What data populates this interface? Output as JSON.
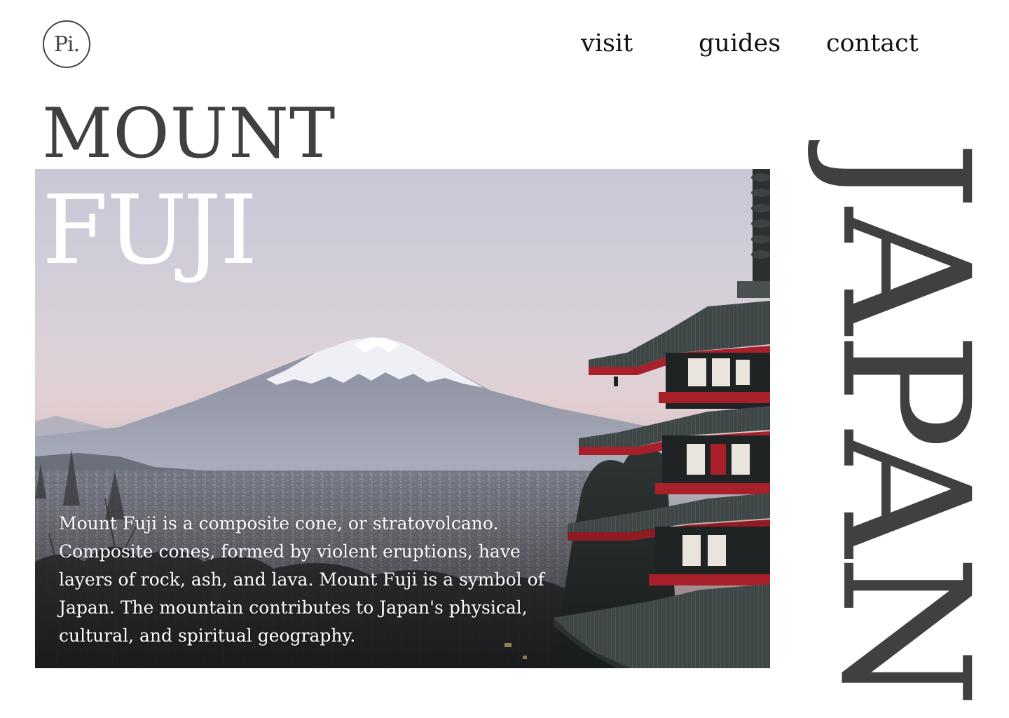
{
  "brand": {
    "logo_text": "Pi."
  },
  "nav": {
    "items": [
      {
        "label": "visit"
      },
      {
        "label": "guides"
      },
      {
        "label": "contact"
      }
    ]
  },
  "hero": {
    "title_top": "MOUNT",
    "title_bottom": "FUJI",
    "description": "Mount Fuji is a composite cone, or stratovolcano. Composite cones, formed by violent eruptions, have layers of rock, ash, and lava. Mount Fuji is a symbol of Japan. The mountain contributes to Japan's physical, cultural, and spiritual geography.",
    "side_word": "JAPAN"
  },
  "colors": {
    "background": "#ffffff",
    "title_dark": "#404040",
    "title_light": "#ffffff",
    "sky_top": "#c8c9d8",
    "sky_bottom": "#e9c9c6",
    "pagoda_red": "#a8202a",
    "roof_dark": "#2f3535"
  },
  "icons": {
    "logo": "circle-logo-icon"
  }
}
